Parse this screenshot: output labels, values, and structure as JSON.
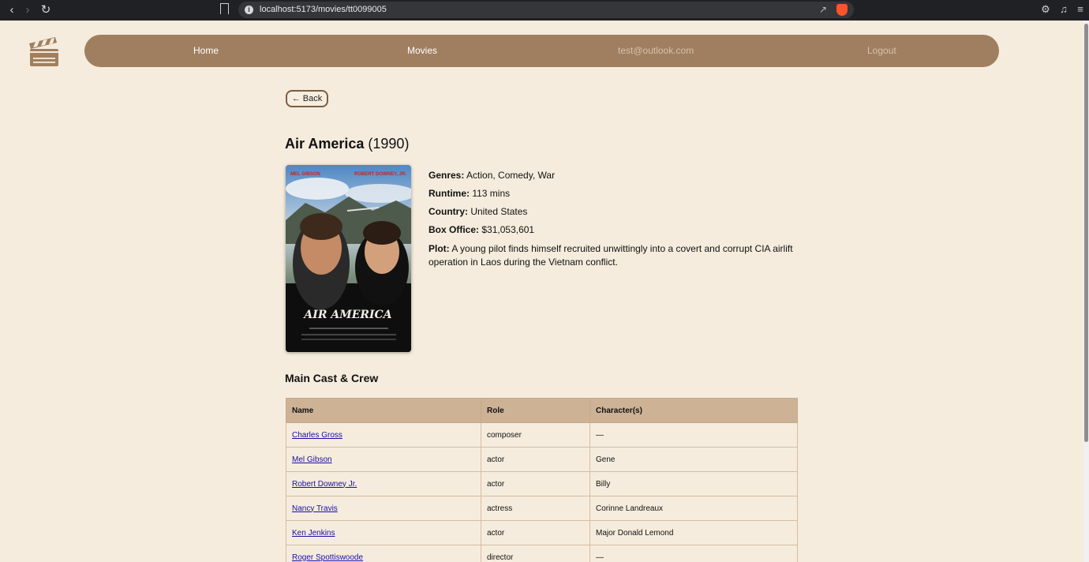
{
  "browser": {
    "url": "localhost:5173/movies/tt0099005"
  },
  "nav": {
    "home": "Home",
    "movies": "Movies",
    "user_email": "test@outlook.com",
    "logout": "Logout"
  },
  "back_label": "← Back",
  "movie": {
    "title": "Air America",
    "year": "(1990)",
    "poster": {
      "top_left_credit": "MEL GIBSON",
      "top_right_credit": "ROBERT DOWNEY, JR.",
      "title_text": "AIR AMERICA"
    },
    "details": {
      "genres_label": "Genres:",
      "genres": "Action, Comedy, War",
      "runtime_label": "Runtime:",
      "runtime": "113 mins",
      "country_label": "Country:",
      "country": "United States",
      "box_office_label": "Box Office:",
      "box_office": "$31,053,601",
      "plot_label": "Plot:",
      "plot": "A young pilot finds himself recruited unwittingly into a covert and corrupt CIA airlift operation in Laos during the Vietnam conflict."
    }
  },
  "cast": {
    "heading": "Main Cast & Crew",
    "columns": [
      "Name",
      "Role",
      "Character(s)"
    ],
    "rows": [
      {
        "name": "Charles Gross",
        "role": "composer",
        "character": "—"
      },
      {
        "name": "Mel Gibson",
        "role": "actor",
        "character": "Gene"
      },
      {
        "name": "Robert Downey Jr.",
        "role": "actor",
        "character": "Billy"
      },
      {
        "name": "Nancy Travis",
        "role": "actress",
        "character": "Corinne Landreaux"
      },
      {
        "name": "Ken Jenkins",
        "role": "actor",
        "character": "Major Donald Lemond"
      },
      {
        "name": "Roger Spottiswoode",
        "role": "director",
        "character": "—"
      }
    ]
  },
  "colors": {
    "page_bg": "#f5ecdd",
    "navbar": "#a07f60",
    "table_header": "#ceb296",
    "link": "#1a0dab"
  }
}
